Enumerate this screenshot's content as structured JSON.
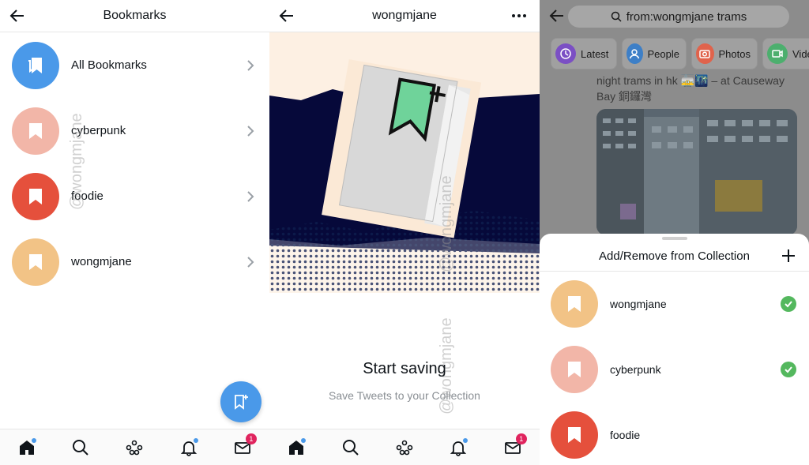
{
  "panel1": {
    "title": "Bookmarks",
    "items": [
      {
        "label": "All Bookmarks",
        "color": "#4a99e9"
      },
      {
        "label": "cyberpunk",
        "color": "#f2b6a8"
      },
      {
        "label": "foodie",
        "color": "#e5503c"
      },
      {
        "label": "wongmjane",
        "color": "#f2c386"
      }
    ],
    "fab_icon": "add-bookmark-icon"
  },
  "panel2": {
    "title": "wongmjane",
    "empty_title": "Start saving",
    "empty_subtitle": "Save Tweets to your Collection"
  },
  "panel3": {
    "search_query": "from:wongmjane trams",
    "chips": [
      {
        "label": "Latest",
        "color": "#7b4fc4"
      },
      {
        "label": "People",
        "color": "#3d7fc7"
      },
      {
        "label": "Photos",
        "color": "#e0634c"
      },
      {
        "label": "Vide",
        "color": "#4caf6e"
      }
    ],
    "tweet_line1": "night trams in hk 🚋🌃 – at Causeway",
    "tweet_line2": "Bay 銅鑼灣",
    "sheet_title": "Add/Remove from Collection",
    "collections": [
      {
        "label": "wongmjane",
        "color": "#f2c386",
        "checked": true
      },
      {
        "label": "cyberpunk",
        "color": "#f2b6a8",
        "checked": true
      },
      {
        "label": "foodie",
        "color": "#e5503c",
        "checked": false
      }
    ]
  },
  "nav": {
    "messages_badge": "1"
  },
  "watermark": "@wongmjane",
  "colors": {
    "accent": "#4a99e9",
    "badge": "#e0245e",
    "check": "#54b85e"
  }
}
